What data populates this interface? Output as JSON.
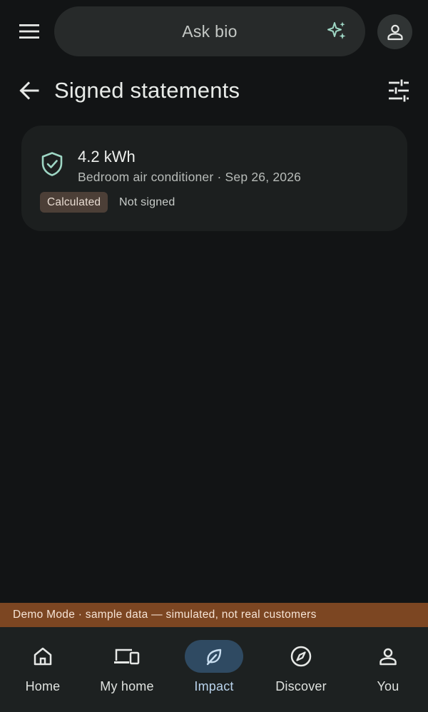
{
  "search": {
    "placeholder": "Ask bio",
    "menu_icon": "menu-icon",
    "assistant_icon": "sparkle-icon",
    "account_icon": "person-icon"
  },
  "header": {
    "title": "Signed statements",
    "back_icon": "arrow-back-icon",
    "filter_icon": "tune-icon"
  },
  "statements": [
    {
      "icon": "verified-shield-icon",
      "energy": "4.2 kWh",
      "subtitle": "Bedroom air conditioner · Sep 26, 2026",
      "tag": "Calculated",
      "status": "Not signed"
    }
  ],
  "banner": {
    "text": "Demo Mode · sample data — simulated, not real customers"
  },
  "nav": {
    "items": [
      {
        "label": "Home",
        "icon": "home-icon",
        "active": false
      },
      {
        "label": "My home",
        "icon": "devices-icon",
        "active": false
      },
      {
        "label": "Impact",
        "icon": "leaf-icon",
        "active": true
      },
      {
        "label": "Discover",
        "icon": "compass-icon",
        "active": false
      },
      {
        "label": "You",
        "icon": "person-icon",
        "active": false
      }
    ]
  },
  "colors": {
    "background": "#121415",
    "accent_green": "#9ed6c4",
    "chip_bg": "#4c3f37",
    "banner_bg": "#7c4622",
    "nav_active_bg": "#2f4a62"
  }
}
